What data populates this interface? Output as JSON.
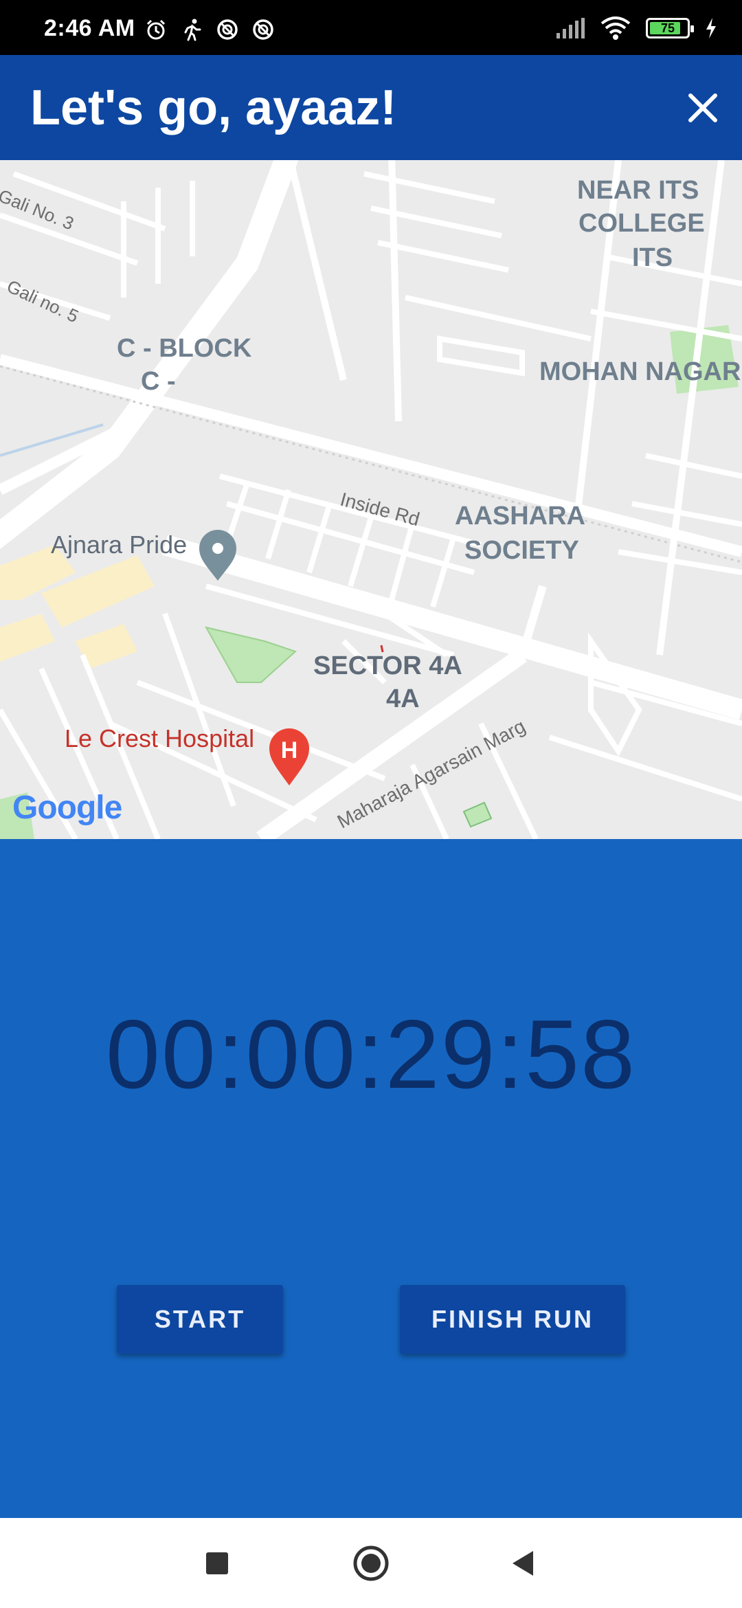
{
  "status_bar": {
    "time": "2:46 AM",
    "battery_level": "75",
    "left_icons": [
      "alarm-icon",
      "running-icon",
      "sync-icon",
      "sync-icon"
    ],
    "right_icons": [
      "signal-icon",
      "wifi-icon",
      "battery-icon",
      "charging-icon"
    ]
  },
  "app_bar": {
    "title": "Let's go, ayaaz!",
    "close_icon": "close-icon"
  },
  "map": {
    "labels": {
      "gali3": "Gali No. 3",
      "gali5": "Gali no. 5",
      "cblock": "C - BLOCK",
      "cblock2": "C -",
      "near_its": "NEAR ITS",
      "college": "COLLEGE",
      "its": "ITS",
      "mohan_nagar": "MOHAN NAGAR",
      "inside_rd": "Inside Rd",
      "aashara": "AASHARA",
      "society": "SOCIETY",
      "ajnara": "Ajnara Pride",
      "sector": "SECTOR 4A",
      "sector2": "4A",
      "hospital": "Le Crest Hospital",
      "maharaja": "Maharaja Agarsain Marg"
    },
    "attribution": "Google"
  },
  "timer": {
    "value": "00:00:29:58"
  },
  "buttons": {
    "start": "START",
    "finish": "FINISH RUN"
  },
  "nav_bar": {
    "icons": [
      "recents-square-icon",
      "home-circle-icon",
      "back-triangle-icon"
    ]
  },
  "colors": {
    "app_bar": "#0d47a1",
    "panel": "#1565c0",
    "timer_text": "#0b2f6b",
    "hospital": "#c5322a"
  }
}
